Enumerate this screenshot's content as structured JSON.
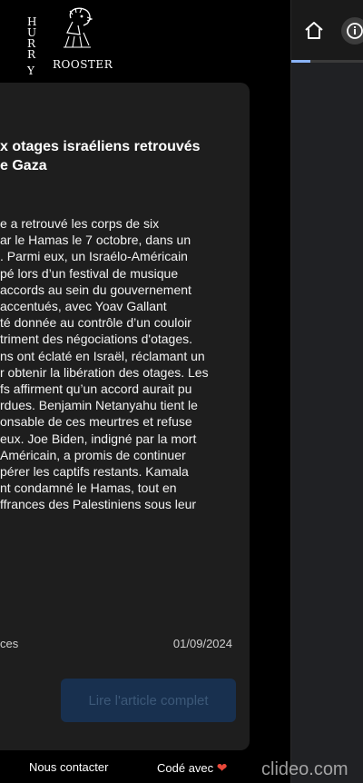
{
  "logo": {
    "letters": [
      "H",
      "U",
      "R",
      "R",
      "Y"
    ],
    "word": "ROOSTER"
  },
  "article": {
    "headline_lines": [
      "x otages israéliens retrouvés",
      "e Gaza"
    ],
    "body_lines": [
      "e a retrouvé les corps de six",
      "ar le Hamas le 7 octobre, dans un",
      ". Parmi eux, un Israélo-Américain",
      "pé lors d’un festival de musique",
      "accords au sein du gouvernement",
      "accentués, avec Yoav Gallant",
      "té donnée au contrôle d’un couloir",
      "triment des négociations d'otages.",
      "ns ont éclaté en Israël, réclamant un",
      "r obtenir la libération des otages. Les",
      "fs affirment qu’un accord aurait pu",
      "rdues. Benjamin Netanyahu tient le",
      "onsable de ces meurtres et refuse",
      "eux. Joe Biden, indigné par la mort",
      "Américain, a promis de continuer",
      "pérer les captifs restants. Kamala",
      "nt condamné le Hamas, tout en",
      "ffrances des Palestiniens sous leur"
    ],
    "source": "ces",
    "date": "01/09/2024",
    "read_button": "Lire l'article complet"
  },
  "footer": {
    "contact": "Nous contacter",
    "coded": "Codé avec",
    "heart": "❤"
  },
  "browser": {
    "home_icon": "home-icon",
    "info_icon": "info-icon",
    "progress": 0.27,
    "accent": "#8ab4f8"
  },
  "watermark": "clideo.com"
}
